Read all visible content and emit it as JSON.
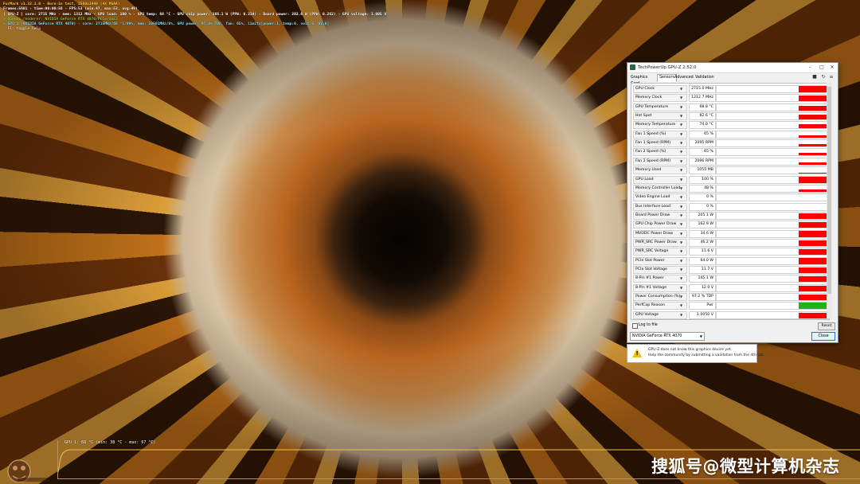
{
  "overlay": {
    "line1": "FurMark v1.32.1.0 - Burn-in test, 2560x1440 (4X MSAA)",
    "line2": "Frames:5601 - time:00:00:56 - FPS:53 (min:47, max:53, avg:49)",
    "line3": "[ GPU-Z ] core: 2715 MHz - mem: 1312 MHz - GPU load: 100 % - GPU temp: 68 °C - GPU chip power: 166.1 W (PPW: 0.319) - Board power: 202.6 W (PPW: 0.262) - GPU voltage: 1.005 V",
    "line4": "> OpenGL renderer: NVIDIA GeForce RTX 4070/PCIe/SSE2",
    "line5": "> GPU 1 (NVIDIA GeForce RTX 4070) - core: 2715MHz/68 °C/99%, mem: 10501MHz/8%, GPU power: 97.8% TDP, fan: 65%, limits[power:1, temp:0, volt:0, OV:0]",
    "line6": "- F1: toggle help"
  },
  "temp_graph": {
    "label": "GPU 1: 68 °C (min: 38 °C - max: 67 °C)",
    "line_color": "#f2c04a"
  },
  "watermark": "搜狐号@微型计算机杂志",
  "gpuz": {
    "title": "TechPowerUp GPU-Z 2.52.0",
    "tabs": [
      "Graphics Card",
      "Sensors",
      "Advanced",
      "Validation"
    ],
    "active_tab": "Sensors",
    "tool_icons": [
      "camera-icon",
      "refresh-icon",
      "menu-icon"
    ],
    "sensors": [
      {
        "name": "GPU Clock",
        "value": "2715.0 MHz",
        "level": 0.95
      },
      {
        "name": "Memory Clock",
        "value": "1312.7 MHz",
        "level": 0.9
      },
      {
        "name": "GPU Temperature",
        "value": "68.8 °C",
        "level": 0.7
      },
      {
        "name": "Hot Spot",
        "value": "82.6 °C",
        "level": 0.75
      },
      {
        "name": "Memory Temperature",
        "value": "74.0 °C",
        "level": 0.7
      },
      {
        "name": "Fan 1 Speed (%)",
        "value": "65 %",
        "level": 0.4
      },
      {
        "name": "Fan 1 Speed (RPM)",
        "value": "2095 RPM",
        "level": 0.4
      },
      {
        "name": "Fan 2 Speed (%)",
        "value": "65 %",
        "level": 0.4
      },
      {
        "name": "Fan 2 Speed (RPM)",
        "value": "2096 RPM",
        "level": 0.4
      },
      {
        "name": "Memory Used",
        "value": "1055 MB",
        "level": 0.15
      },
      {
        "name": "GPU Load",
        "value": "100 %",
        "level": 0.95
      },
      {
        "name": "Memory Controller Load",
        "value": "48 %",
        "level": 0.35
      },
      {
        "name": "Video Engine Load",
        "value": "0 %",
        "level": 0
      },
      {
        "name": "Bus Interface Load",
        "value": "0 %",
        "level": 0
      },
      {
        "name": "Board Power Draw",
        "value": "205.1 W",
        "level": 0.9
      },
      {
        "name": "GPU Chip Power Draw",
        "value": "162.9 W",
        "level": 0.9
      },
      {
        "name": "MVDDC Power Draw",
        "value": "34.6 W",
        "level": 0.9
      },
      {
        "name": "PWR_SRC Power Draw",
        "value": "46.2 W",
        "level": 0.9
      },
      {
        "name": "PWR_SRC Voltage",
        "value": "11.6 V",
        "level": 0.9
      },
      {
        "name": "PCIe Slot Power",
        "value": "64.0 W",
        "level": 0.9
      },
      {
        "name": "PCIe Slot Voltage",
        "value": "11.7 V",
        "level": 0.9
      },
      {
        "name": "8-Pin #1 Power",
        "value": "145.1 W",
        "level": 0.9
      },
      {
        "name": "8-Pin #1 Voltage",
        "value": "12.0 V",
        "level": 0.9
      },
      {
        "name": "Power Consumption (%)",
        "value": "97.2 % TDP",
        "level": 0.9
      },
      {
        "name": "PerfCap Reason",
        "value": "Pwr",
        "level": 1,
        "color": "#1db31d"
      },
      {
        "name": "GPU Voltage",
        "value": "1.0050 V",
        "level": 0.8
      }
    ],
    "log_label": "Log to file",
    "reset_label": "Reset",
    "device": "NVIDIA GeForce RTX 4070",
    "close_label": "Close",
    "notice_line1": "GPU-Z does not know this graphics device yet.",
    "notice_line2": "Help the community by submitting a validation from the 4th tab."
  }
}
